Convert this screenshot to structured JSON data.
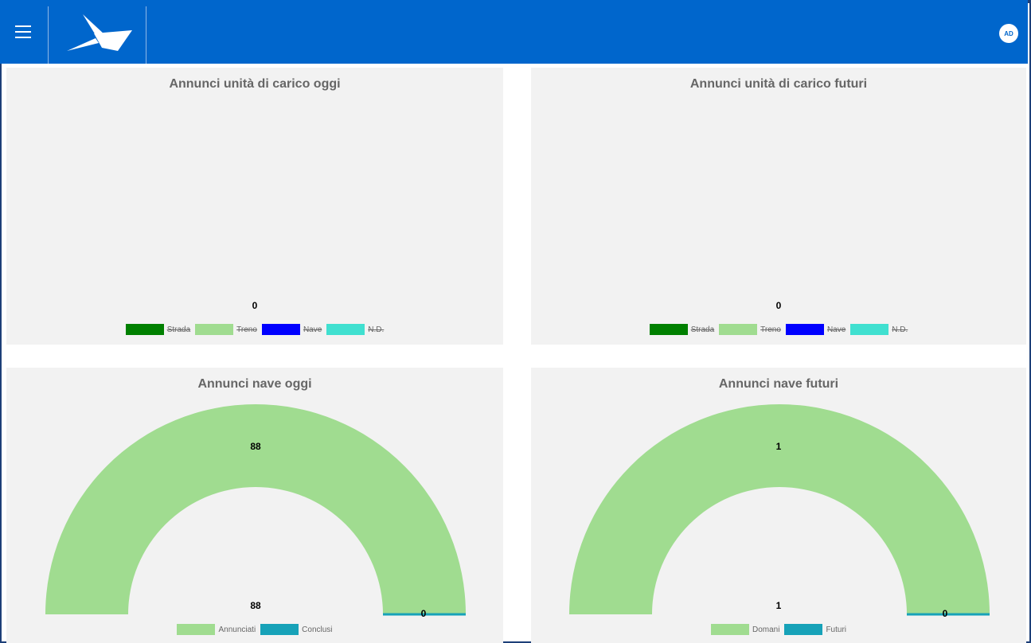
{
  "header": {
    "avatar_initials": "AD",
    "bar_color": "#0066cc"
  },
  "panels": {
    "uc_today": {
      "title": "Annunci unità di carico oggi",
      "total": "0",
      "legend": [
        {
          "label": "Strada",
          "color": "#008000",
          "hidden": true
        },
        {
          "label": "Treno",
          "color": "#a0dc90",
          "hidden": true
        },
        {
          "label": "Nave",
          "color": "#0000ff",
          "hidden": true
        },
        {
          "label": "N.D.",
          "color": "#40e0d0",
          "hidden": true
        }
      ]
    },
    "uc_future": {
      "title": "Annunci unità di carico futuri",
      "total": "0",
      "legend": [
        {
          "label": "Strada",
          "color": "#008000",
          "hidden": true
        },
        {
          "label": "Treno",
          "color": "#a0dc90",
          "hidden": true
        },
        {
          "label": "Nave",
          "color": "#0000ff",
          "hidden": true
        },
        {
          "label": "N.D.",
          "color": "#40e0d0",
          "hidden": true
        }
      ]
    },
    "ship_today": {
      "title": "Annunci nave oggi",
      "top_value": "88",
      "bottom_value": "88",
      "right_value": "0",
      "legend": [
        {
          "label": "Annunciati",
          "color": "#a0dc90"
        },
        {
          "label": "Conclusi",
          "color": "#17a2b8"
        }
      ]
    },
    "ship_future": {
      "title": "Annunci nave futuri",
      "top_value": "1",
      "bottom_value": "1",
      "right_value": "0",
      "legend": [
        {
          "label": "Domani",
          "color": "#a0dc90"
        },
        {
          "label": "Futuri",
          "color": "#17a2b8"
        }
      ]
    }
  },
  "chart_data": [
    {
      "type": "bar",
      "title": "Annunci unità di carico oggi",
      "categories": [],
      "series": [
        {
          "name": "Strada",
          "values": [],
          "hidden": true
        },
        {
          "name": "Treno",
          "values": [],
          "hidden": true
        },
        {
          "name": "Nave",
          "values": [],
          "hidden": true
        },
        {
          "name": "N.D.",
          "values": [],
          "hidden": true
        }
      ],
      "total": 0
    },
    {
      "type": "bar",
      "title": "Annunci unità di carico futuri",
      "categories": [],
      "series": [
        {
          "name": "Strada",
          "values": [],
          "hidden": true
        },
        {
          "name": "Treno",
          "values": [],
          "hidden": true
        },
        {
          "name": "Nave",
          "values": [],
          "hidden": true
        },
        {
          "name": "N.D.",
          "values": [],
          "hidden": true
        }
      ],
      "total": 0
    },
    {
      "type": "pie",
      "subtype": "half-doughnut-gauge",
      "title": "Annunci nave oggi",
      "categories": [
        "Annunciati",
        "Conclusi"
      ],
      "values": [
        88,
        0
      ],
      "colors": [
        "#a0dc90",
        "#17a2b8"
      ]
    },
    {
      "type": "pie",
      "subtype": "half-doughnut-gauge",
      "title": "Annunci nave futuri",
      "categories": [
        "Domani",
        "Futuri"
      ],
      "values": [
        1,
        0
      ],
      "colors": [
        "#a0dc90",
        "#17a2b8"
      ]
    }
  ]
}
